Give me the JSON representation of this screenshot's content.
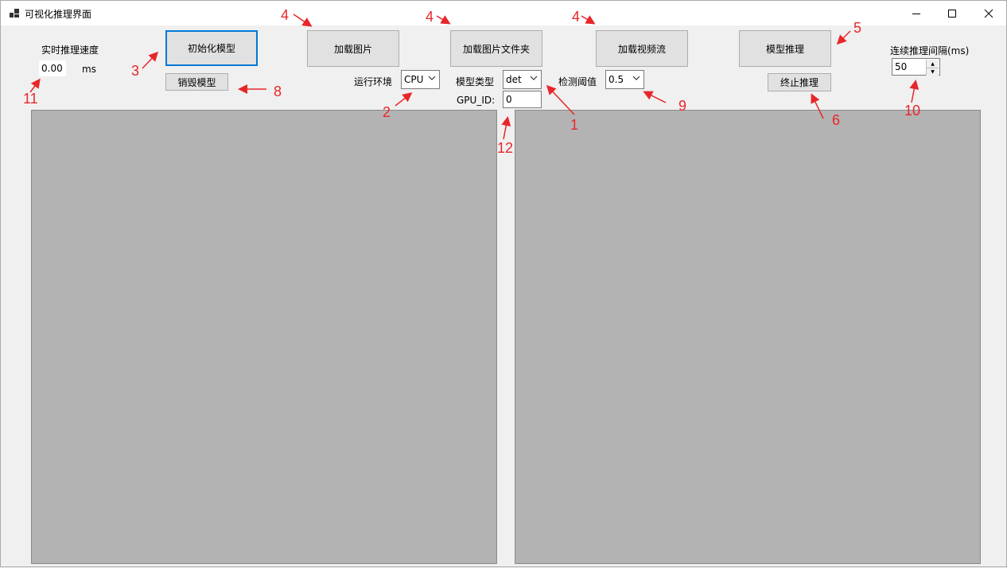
{
  "window": {
    "title": "可视化推理界面",
    "minimize_icon": "minimize-icon",
    "maximize_icon": "maximize-icon",
    "close_icon": "close-icon"
  },
  "speed": {
    "label": "实时推理速度",
    "value": "0.00",
    "unit": "ms"
  },
  "buttons": {
    "init_model": "初始化模型",
    "destroy_model": "销毁模型",
    "load_image": "加载图片",
    "load_folder": "加载图片文件夹",
    "load_video": "加载视频流",
    "infer": "模型推理",
    "stop_infer": "终止推理"
  },
  "settings": {
    "env_label": "运行环境",
    "env_value": "CPU",
    "model_type_label": "模型类型",
    "model_type_value": "det",
    "gpu_id_label": "GPU_ID:",
    "gpu_id_value": "0",
    "threshold_label": "检测阈值",
    "threshold_value": "0.5",
    "interval_label": "连续推理间隔(ms)",
    "interval_value": "50"
  },
  "annotations": {
    "n1": "1",
    "n2": "2",
    "n3": "3",
    "n4a": "4",
    "n4b": "4",
    "n4c": "4",
    "n5": "5",
    "n6": "6",
    "n8": "8",
    "n9": "9",
    "n10": "10",
    "n11": "11",
    "n12": "12"
  },
  "colors": {
    "annotation": "#e8262a",
    "accent": "#0078d7",
    "panel": "#b3b3b3"
  }
}
